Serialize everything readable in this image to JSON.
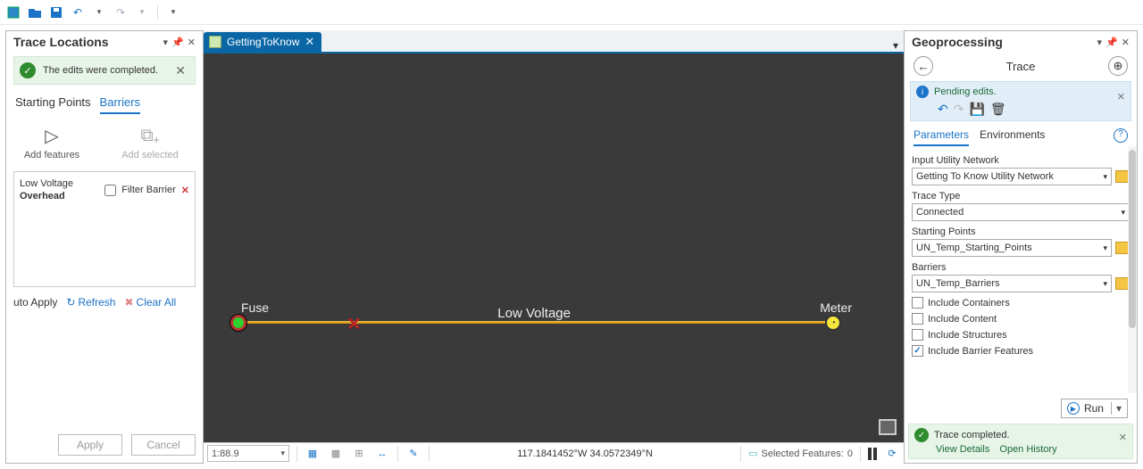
{
  "qat": {
    "undo": "↶",
    "redo": "↷"
  },
  "left": {
    "title": "Trace Locations",
    "msg": "The edits were completed.",
    "tabs": {
      "starting": "Starting Points",
      "barriers": "Barriers"
    },
    "tools": {
      "add_features": "Add features",
      "add_selected": "Add selected"
    },
    "barrier_item": {
      "line1": "Low Voltage",
      "line2": "Overhead",
      "filter": "Filter Barrier"
    },
    "auto_apply": "uto Apply",
    "refresh": "Refresh",
    "clear_all": "Clear All",
    "apply": "Apply",
    "cancel": "Cancel"
  },
  "map": {
    "tab_name": "GettingToKnow",
    "fuse": "Fuse",
    "meter": "Meter",
    "lv": "Low Voltage",
    "status": {
      "scale": "1:88.9",
      "coords": "117.1841452°W 34.0572349°N",
      "selected_label": "Selected Features:",
      "selected_count": "0"
    }
  },
  "gp": {
    "title": "Geoprocessing",
    "tool": "Trace",
    "pending": "Pending edits.",
    "tabs": {
      "params": "Parameters",
      "envs": "Environments"
    },
    "params": {
      "network_label": "Input Utility Network",
      "network_value": "Getting To Know Utility Network",
      "trace_label": "Trace Type",
      "trace_value": "Connected",
      "sp_label": "Starting Points",
      "sp_value": "UN_Temp_Starting_Points",
      "bar_label": "Barriers",
      "bar_value": "UN_Temp_Barriers",
      "inc_containers": "Include Containers",
      "inc_content": "Include Content",
      "inc_structures": "Include Structures",
      "inc_barrierf": "Include Barrier Features"
    },
    "run": "Run",
    "complete": {
      "msg": "Trace completed.",
      "view": "View Details",
      "open": "Open History"
    }
  }
}
